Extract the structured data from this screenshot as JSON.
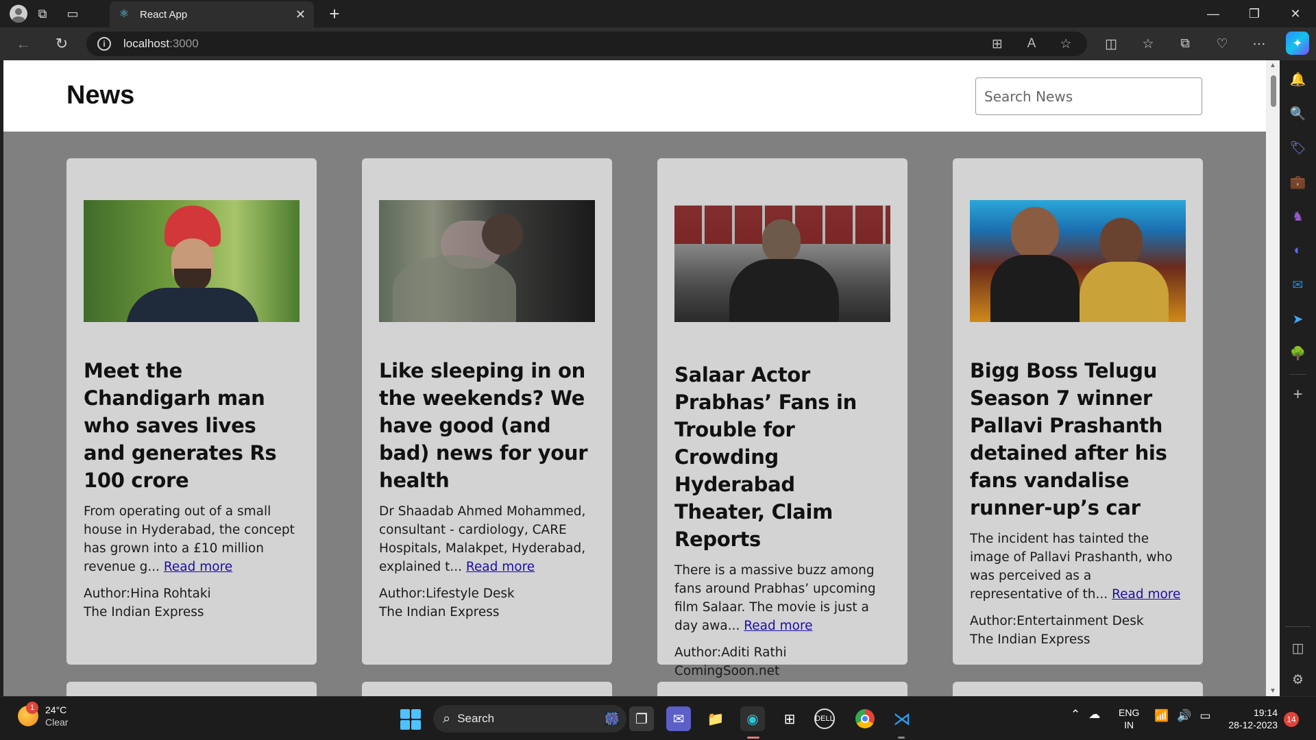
{
  "browser": {
    "tab_title": "React App",
    "url_host": "localhost",
    "url_port": ":3000"
  },
  "page": {
    "brand": "News",
    "search_placeholder": "Search News"
  },
  "articles": [
    {
      "title": "Meet the Chandigarh man who saves lives and generates Rs 100 crore",
      "desc": "From operating out of a small house in Hyderabad, the concept has grown into a £10 million revenue g...",
      "read_more": "Read more",
      "author": "Author:Hina Rohtaki",
      "source": "The Indian Express"
    },
    {
      "title": "Like sleeping in on the weekends? We have good (and bad) news for your health",
      "desc": "Dr Shaadab Ahmed Mohammed, consultant - cardiology, CARE Hospitals, Malakpet, Hyderabad, explained t...",
      "read_more": "Read more",
      "author": "Author:Lifestyle Desk",
      "source": "The Indian Express"
    },
    {
      "title": "Salaar Actor Prabhas’ Fans in Trouble for Crowding Hyderabad Theater, Claim Reports",
      "desc": "There is a massive buzz among fans around Prabhas’ upcoming film Salaar. The movie is just a day awa...",
      "read_more": "Read more",
      "author": "Author:Aditi Rathi",
      "source": "ComingSoon.net"
    },
    {
      "title": "Bigg Boss Telugu Season 7 winner Pallavi Prashanth detained after his fans vandalise runner-up’s car",
      "desc": "The incident has tainted the image of Pallavi Prashanth, who was perceived as a representative of th...",
      "read_more": "Read more",
      "author": "Author:Entertainment Desk",
      "source": "The Indian Express"
    }
  ],
  "taskbar": {
    "weather_temp": "24°C",
    "weather_cond": "Clear",
    "weather_badge": "1",
    "search_label": "Search",
    "lang_1": "ENG",
    "lang_2": "IN",
    "time": "19:14",
    "date": "28-12-2023",
    "notifications": "14"
  }
}
